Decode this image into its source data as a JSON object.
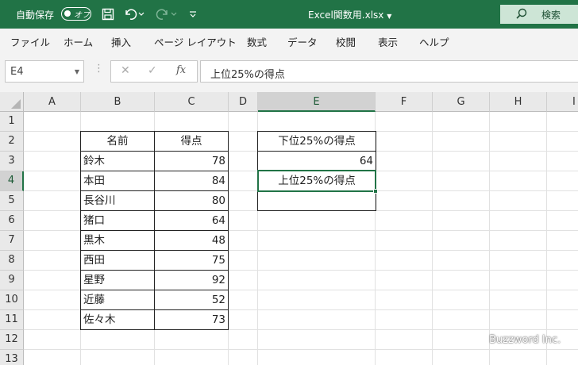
{
  "titlebar": {
    "autosave_label": "自動保存",
    "autosave_state": "オフ",
    "file_title": "Excel関数用.xlsx",
    "search_label": "検索",
    "accent_color": "#217346"
  },
  "menu": {
    "items": [
      "ファイル",
      "ホーム",
      "挿入",
      "ページ レイアウト",
      "数式",
      "データ",
      "校閲",
      "表示",
      "ヘルプ"
    ]
  },
  "formula_bar": {
    "name_box": "E4",
    "cancel_symbol": "✕",
    "enter_symbol": "✓",
    "fx_symbol": "fx",
    "content": "上位25%の得点"
  },
  "sheet": {
    "columns": [
      "A",
      "B",
      "C",
      "D",
      "E",
      "F",
      "G",
      "H",
      "I"
    ],
    "rows": [
      "1",
      "2",
      "3",
      "4",
      "5",
      "6",
      "7",
      "8",
      "9",
      "10",
      "11",
      "12",
      "13"
    ],
    "selected_cell": "E4",
    "table": {
      "header_name": "名前",
      "header_score": "得点",
      "names": [
        "鈴木",
        "本田",
        "長谷川",
        "猪口",
        "黒木",
        "西田",
        "星野",
        "近藤",
        "佐々木"
      ],
      "scores": [
        "78",
        "84",
        "80",
        "64",
        "48",
        "75",
        "92",
        "52",
        "73"
      ]
    },
    "side": {
      "e2": "下位25%の得点",
      "e3": "64",
      "e4": "上位25%の得点",
      "e5": ""
    }
  },
  "watermark": "Buzzword Inc."
}
